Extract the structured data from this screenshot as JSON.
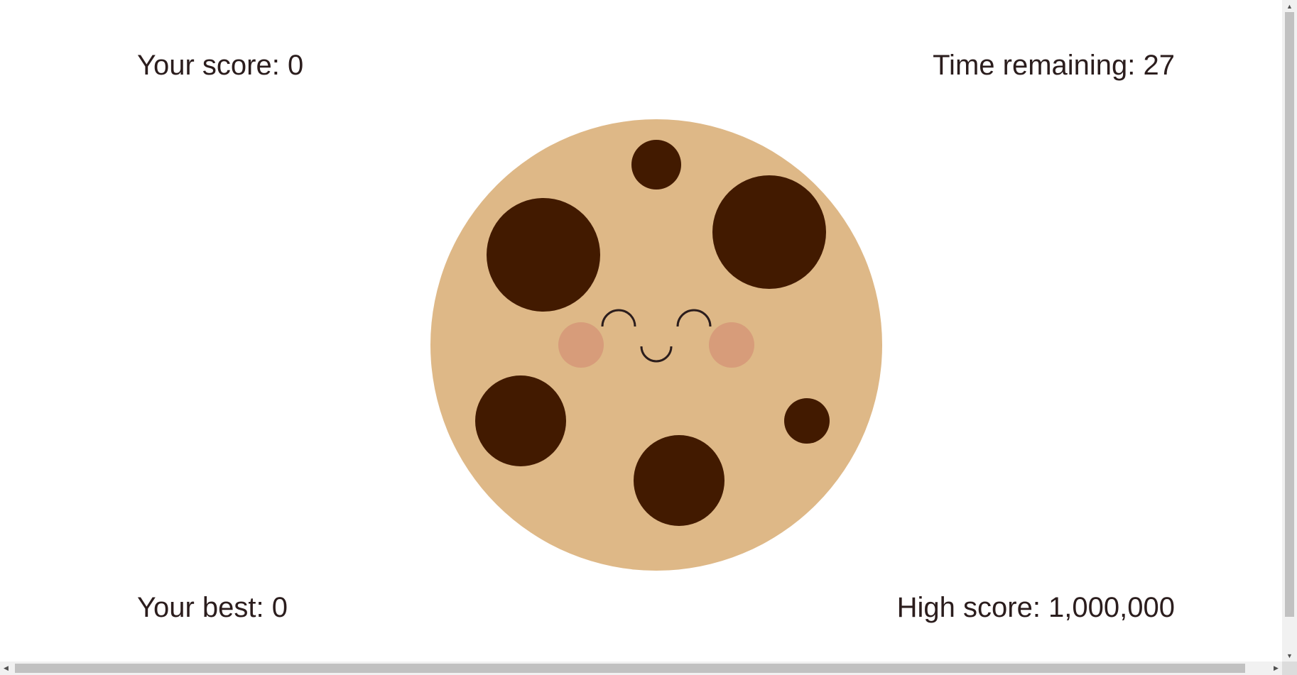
{
  "game": {
    "score_text": "Your score: 0",
    "time_text": "Time remaining: 27",
    "best_text": "Your best: 0",
    "high_score_text": "High score: 1,000,000",
    "score": 0,
    "time_remaining": 27,
    "best": 0,
    "high_score": 1000000
  },
  "cookie": {
    "icon": "cookie-icon",
    "dough_color": "#deb887",
    "chip_color": "#421a00",
    "cheek_color": "#d79c7a",
    "face_color": "#2b1d1d"
  },
  "scrollbars": {
    "up_glyph": "▲",
    "down_glyph": "▼",
    "left_glyph": "◀",
    "right_glyph": "▶"
  }
}
